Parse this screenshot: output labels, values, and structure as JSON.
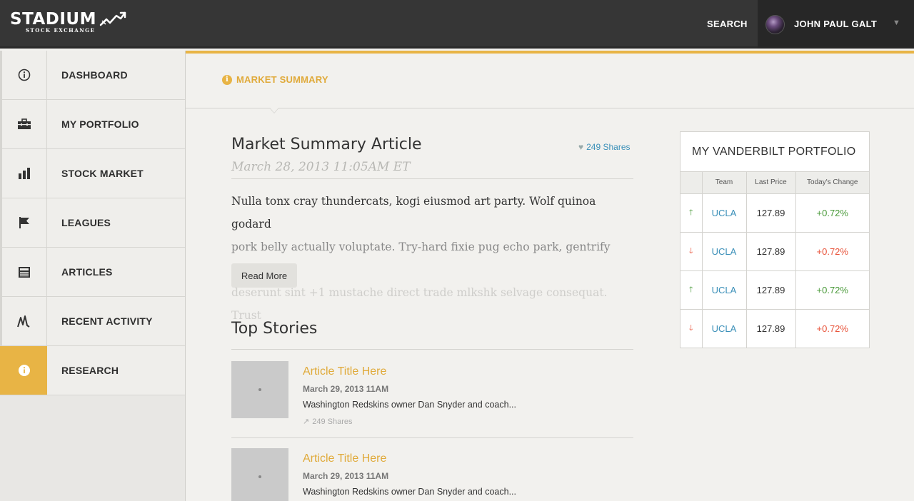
{
  "header": {
    "logo_main": "STADIUM",
    "logo_sub": "STOCK EXCHANGE",
    "search_label": "SEARCH",
    "user_name": "JOHN PAUL GALT",
    "caret": "▼"
  },
  "sidebar": {
    "items": [
      {
        "label": "DASHBOARD",
        "icon": "info-icon"
      },
      {
        "label": "MY PORTFOLIO",
        "icon": "briefcase-icon"
      },
      {
        "label": "STOCK MARKET",
        "icon": "bar-chart-icon"
      },
      {
        "label": "LEAGUES",
        "icon": "flag-icon"
      },
      {
        "label": "ARTICLES",
        "icon": "newspaper-icon"
      },
      {
        "label": "RECENT ACTIVITY",
        "icon": "activity-icon"
      },
      {
        "label": "RESEARCH",
        "icon": "info-icon",
        "active": true
      }
    ]
  },
  "breadcrumb": {
    "icon": "i",
    "label": "MARKET SUMMARY"
  },
  "article": {
    "title": "Market Summary Article",
    "shares": "249 Shares",
    "date": "March 28, 2013 11:05AM ET",
    "line1": "Nulla tonx cray thundercats, kogi eiusmod art party. Wolf quinoa godard",
    "line2": "pork belly actually voluptate. Try-hard fixie pug echo park, gentrify etsy eu",
    "line3": "deserunt sint +1 mustache direct trade mlkshk selvage consequat. Trust",
    "read_more": "Read More"
  },
  "top_stories": {
    "heading": "Top Stories",
    "items": [
      {
        "title": "Article Title Here",
        "date": "March 29, 2013 11AM",
        "desc": "Washington Redskins owner Dan Snyder and coach...",
        "shares": "249 Shares"
      },
      {
        "title": "Article Title Here",
        "date": "March 29, 2013 11AM",
        "desc": "Washington Redskins owner Dan Snyder and coach..."
      }
    ]
  },
  "portfolio": {
    "title": "MY VANDERBILT PORTFOLIO",
    "columns": [
      "",
      "Team",
      "Last Price",
      "Today's Change"
    ],
    "rows": [
      {
        "dir": "up",
        "arrow": "🡑",
        "team": "UCLA",
        "price": "127.89",
        "change": "+0.72%"
      },
      {
        "dir": "down",
        "arrow": "🡓",
        "team": "UCLA",
        "price": "127.89",
        "change": "+0.72%"
      },
      {
        "dir": "up",
        "arrow": "🡑",
        "team": "UCLA",
        "price": "127.89",
        "change": "+0.72%"
      },
      {
        "dir": "down",
        "arrow": "🡓",
        "team": "UCLA",
        "price": "127.89",
        "change": "+0.72%"
      }
    ]
  },
  "colors": {
    "accent": "#e8b445",
    "header_bg": "#363636",
    "link": "#3a8fb8",
    "positive": "#4a9a3a",
    "negative": "#e8533a"
  }
}
